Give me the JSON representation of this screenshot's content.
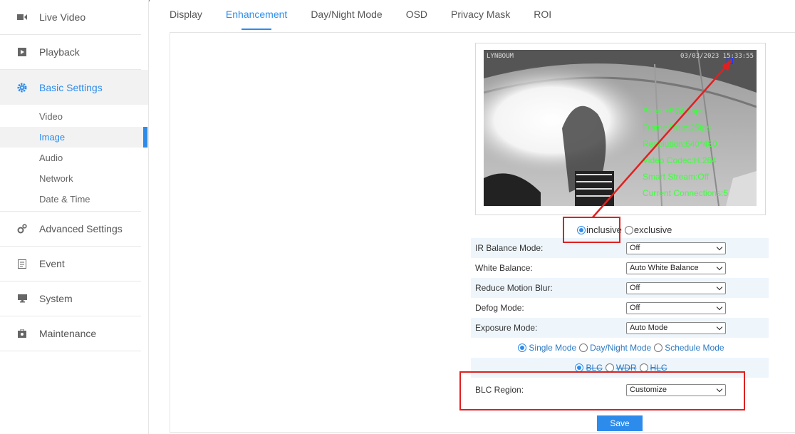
{
  "sidebar": {
    "items": [
      {
        "label": "Live Video",
        "icon": "video-camera-icon"
      },
      {
        "label": "Playback",
        "icon": "play-icon"
      },
      {
        "label": "Basic Settings",
        "icon": "gear-icon"
      },
      {
        "label": "Advanced Settings",
        "icon": "gears-icon"
      },
      {
        "label": "Event",
        "icon": "event-icon"
      },
      {
        "label": "System",
        "icon": "monitor-icon"
      },
      {
        "label": "Maintenance",
        "icon": "toolbox-icon"
      }
    ],
    "sub_items": [
      "Video",
      "Image",
      "Audio",
      "Network",
      "Date & Time"
    ]
  },
  "tabs": [
    "Display",
    "Enhancement",
    "Day/Night Mode",
    "OSD",
    "Privacy Mask",
    "ROI"
  ],
  "video": {
    "osd_left": "LYNBOUM",
    "osd_right": "03/03/2023 15:33:55",
    "stats": [
      "Bitrate:574 kbps",
      "Frame Rate:25fps",
      "Resolution:640*480",
      "Video Codec:H.264",
      "Smart Stream:Off",
      "Current Connections:5"
    ]
  },
  "region_mode": {
    "inclusive": "inclusive",
    "exclusive": "exclusive"
  },
  "settings": [
    {
      "label": "IR Balance Mode:",
      "value": "Off"
    },
    {
      "label": "White Balance:",
      "value": "Auto White Balance"
    },
    {
      "label": "Reduce Motion Blur:",
      "value": "Off"
    },
    {
      "label": "Defog Mode:",
      "value": "Off"
    },
    {
      "label": "Exposure Mode:",
      "value": "Auto Mode"
    }
  ],
  "modes": {
    "single": "Single Mode",
    "day_night": "Day/Night Mode",
    "schedule": "Schedule Mode"
  },
  "backlight": {
    "blc": "BLC",
    "wdr": "WDR",
    "hlc": "HLC"
  },
  "blc_region": {
    "label": "BLC Region:",
    "value": "Customize"
  },
  "save_label": "Save",
  "colors": {
    "accent": "#2d8ceb",
    "annotation": "#e02020",
    "osd_text": "#3cff3c"
  }
}
